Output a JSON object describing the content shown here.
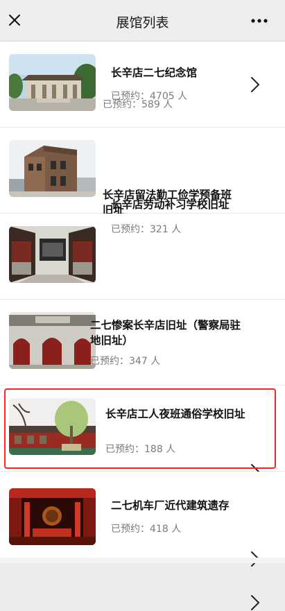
{
  "nav": {
    "title": "展馆列表",
    "close_icon": "close-icon",
    "more_icon": "more-icon"
  },
  "colors": {
    "highlight": "#ff2020",
    "count_text": "#7a7a7a"
  },
  "venues": [
    {
      "name": "长辛店二七纪念馆",
      "count_label": "已预约：4705 人",
      "icon": "chevron-right-icon"
    },
    {
      "name": "长辛店留法勤工俭学预备班旧址",
      "count_label": "已预约：589 人",
      "icon": "chevron-right-icon"
    },
    {
      "name": "长辛店劳动补习学校旧址",
      "count_label": "已预约：321 人",
      "icon": "chevron-right-icon"
    },
    {
      "name": "二七惨案长辛店旧址（警察局驻地旧址）",
      "count_label": "已预约：347 人",
      "icon": "chevron-right-icon"
    },
    {
      "name": "长辛店工人夜班通俗学校旧址",
      "count_label": "已预约：188 人",
      "icon": "chevron-right-icon",
      "highlighted": true
    },
    {
      "name": "二七机车厂近代建筑遗存",
      "count_label": "已预约：418 人",
      "icon": "chevron-right-icon"
    }
  ]
}
